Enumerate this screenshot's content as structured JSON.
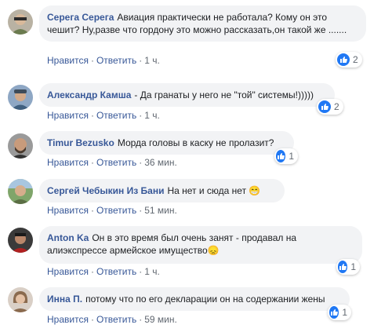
{
  "colors": {
    "link": "#385898",
    "bubble": "#f2f3f5",
    "like": "#2078f4",
    "meta": "#606770"
  },
  "action_labels": {
    "like": "Нравится",
    "reply": "Ответить",
    "sep": "·"
  },
  "comments": [
    {
      "author": "Серега Серега",
      "text": "Авиация практически не работала? Кому он это чешит? Ну,разве что гордону это можно рассказать,он такой же .......",
      "time": "1 ч.",
      "likes": "2",
      "avatar_icon": "avatar-man-sunglasses"
    },
    {
      "author": "Александр Камша",
      "text": "- Да гранаты у него не \"той\" системы!)))))",
      "time": "1 ч.",
      "likes": "2",
      "avatar_icon": "avatar-man-cap"
    },
    {
      "author": "Timur Bezusko",
      "text": "Морда головы в каску не пролазит?",
      "time": "36 мин.",
      "likes": "1",
      "avatar_icon": "avatar-man-beard"
    },
    {
      "author": "Сергей Чебыкин Из Бани",
      "text": "На нет и сюда нет 😁",
      "time": "51 мин.",
      "likes": "",
      "avatar_icon": "avatar-man-outdoor"
    },
    {
      "author": "Anton Ka",
      "text": "Он в это время был очень занят - продавал на алиэкспрессе армейское имущество😞",
      "time": "1 ч.",
      "likes": "1",
      "avatar_icon": "avatar-man-dark"
    },
    {
      "author": "Инна П.",
      "text": "потому что по его декларации он на содержании жены",
      "time": "59 мин.",
      "likes": "1",
      "avatar_icon": "avatar-woman"
    }
  ]
}
